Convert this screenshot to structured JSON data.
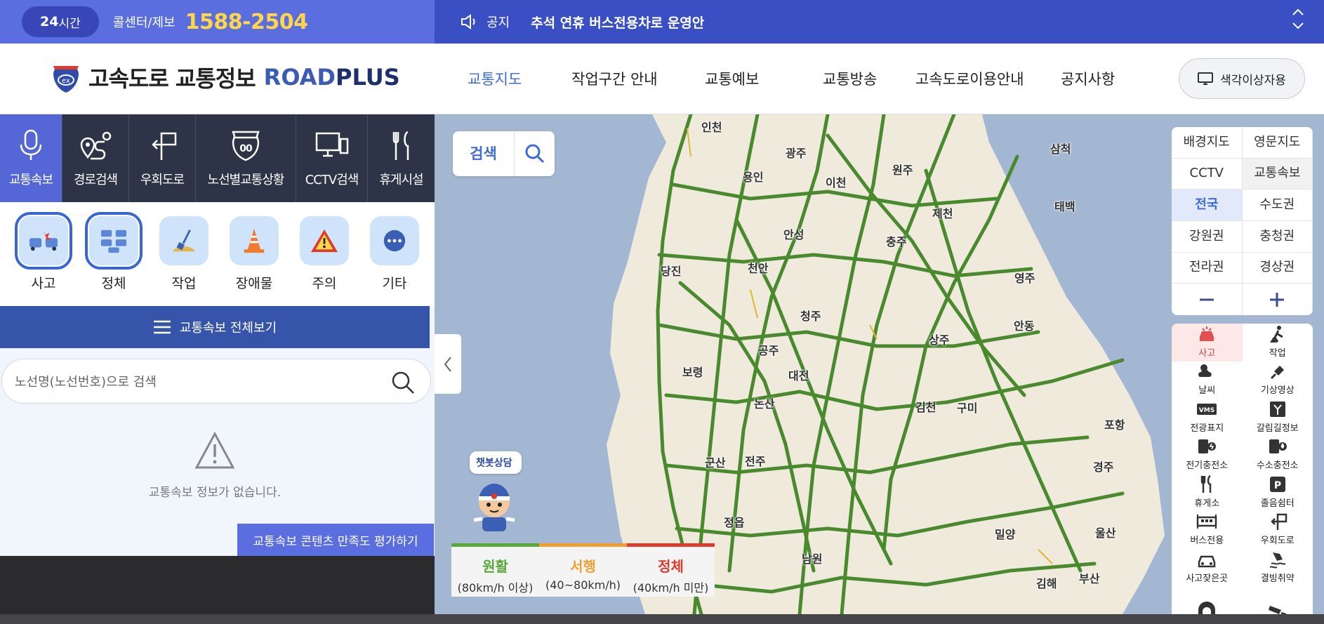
{
  "topbar": {
    "badge_bold": "24",
    "badge_rest": "시간",
    "callcenter_label": "콜센터/제보",
    "phone": "1588-2504",
    "notice_label": "공지",
    "notice_text": "추석 연휴 버스전용차로 운영안"
  },
  "header": {
    "logo_kr": "고속도로 교통정보",
    "logo_en_1": "ROAD",
    "logo_en_2": "PLUS",
    "nav": [
      "교통지도",
      "작업구간 안내",
      "교통예보",
      "교통방송",
      "고속도로이용안내",
      "공지사항"
    ],
    "color_btn": "색각이상자용"
  },
  "left_panel": {
    "tabs": [
      "교통속보",
      "경로검색",
      "우회도로",
      "노선별교통상황",
      "CCTV검색",
      "휴게시설"
    ],
    "categories": [
      "사고",
      "정체",
      "작업",
      "장애물",
      "주의",
      "기타"
    ],
    "all_view": "교통속보 전체보기",
    "search_placeholder": "노선명(노선번호)으로 검색",
    "empty_msg": "교통속보 정보가 없습니다.",
    "survey_btn": "교통속보 콘텐츠 만족도 평가하기"
  },
  "map": {
    "search_label": "검색",
    "chatbot": "챗봇상담",
    "legend": [
      {
        "name": "원활",
        "sub": "(80km/h 이상)",
        "color": "#5aa83c"
      },
      {
        "name": "서행",
        "sub": "(40~80km/h)",
        "color": "#f0a030"
      },
      {
        "name": "정체",
        "sub": "(40km/h 미만)",
        "color": "#e03a2a"
      }
    ],
    "cities": [
      "인천",
      "광주",
      "원주",
      "삼척",
      "용인",
      "이천",
      "제천",
      "태백",
      "안성",
      "충주",
      "당진",
      "천안",
      "영주",
      "청주",
      "안동",
      "공주",
      "상주",
      "보령",
      "대전",
      "논산",
      "김천",
      "구미",
      "포항",
      "군산",
      "전주",
      "경주",
      "정읍",
      "밀양",
      "울산",
      "남원",
      "김해",
      "부산"
    ]
  },
  "right_panel": {
    "top": [
      [
        "배경",
        "지도"
      ],
      [
        "영문",
        "지도"
      ],
      [
        "CCTV"
      ],
      [
        "교통",
        "속보"
      ],
      [
        "전국"
      ],
      [
        "수도권"
      ],
      [
        "강원권"
      ],
      [
        "충청권"
      ],
      [
        "전라권"
      ],
      [
        "경상권"
      ]
    ],
    "layers": [
      "사고",
      "작업",
      "날씨",
      "기상영상",
      "전광표지",
      "갈림길정보",
      "전기충전소",
      "수소충전소",
      "휴게소",
      "졸음쉼터",
      "버스전용",
      "우회도로",
      "사고잦은곳",
      "결빙취약"
    ],
    "vms_text": "VMS"
  },
  "colors": {
    "accent": "#5a6ee0",
    "dark_blue": "#3654aa",
    "road": "#4a8a2e"
  }
}
